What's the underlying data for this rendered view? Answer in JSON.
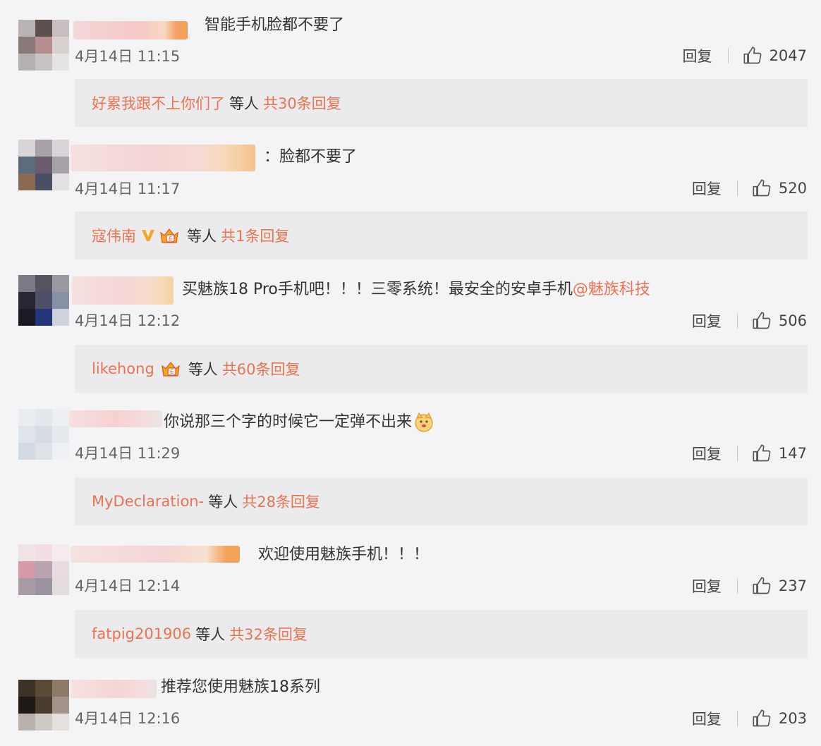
{
  "comments": [
    {
      "text": "智能手机脸都不要了",
      "time": "4月14日 11:15",
      "reply_label": "回复",
      "likes": "2047",
      "replies": {
        "users": "好累我跟不上你们了",
        "mid": "等人",
        "count": "共30条回复"
      }
    },
    {
      "text": "：脸都不要了",
      "time": "4月14日 11:17",
      "reply_label": "回复",
      "likes": "520",
      "replies": {
        "users": "寇伟南",
        "mid": "等人",
        "count": "共1条回复"
      }
    },
    {
      "text": "买魅族18 Pro手机吧！！！三零系统！最安全的安卓手机",
      "mention": "@魅族科技",
      "time": "4月14日 12:12",
      "reply_label": "回复",
      "likes": "506",
      "replies": {
        "users": "likehong",
        "mid": "等人",
        "count": "共60条回复"
      }
    },
    {
      "text": "你说那三个字的时候它一定弹不出来",
      "time": "4月14日 11:29",
      "reply_label": "回复",
      "likes": "147",
      "replies": {
        "users": "MyDeclaration-",
        "mid": "等人",
        "count": "共28条回复"
      }
    },
    {
      "text": "欢迎使用魅族手机！！！",
      "time": "4月14日 12:14",
      "reply_label": "回复",
      "likes": "237",
      "replies": {
        "users": "fatpig201906",
        "mid": "等人",
        "count": "共32条回复"
      }
    },
    {
      "text": "推荐您使用魅族18系列",
      "time": "4月14日 12:16",
      "reply_label": "回复",
      "likes": "203"
    }
  ],
  "icons": {
    "like": "thumbs-up-icon",
    "verified": "verified-v-icon",
    "crown": "vip-crown-icon",
    "emoji": "doge-emoji-icon"
  },
  "colors": {
    "accent": "#eb7350",
    "background": "#f4f4f6",
    "reply_box": "#ebebed",
    "text": "#333333",
    "muted": "#666666"
  }
}
